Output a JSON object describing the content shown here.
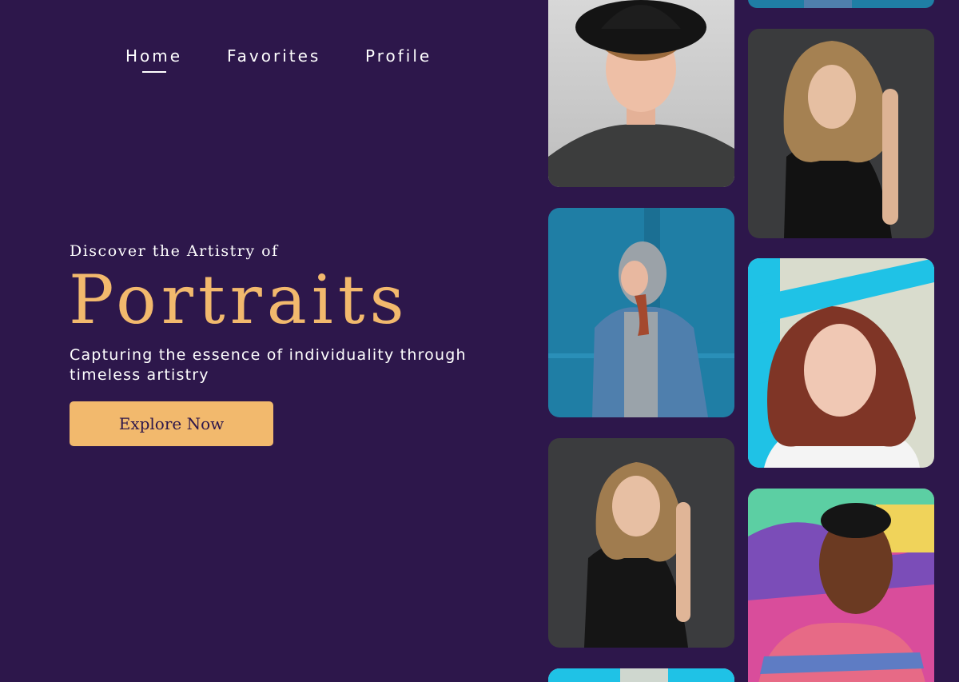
{
  "nav": {
    "items": [
      {
        "label": "Home",
        "active": true
      },
      {
        "label": "Favorites",
        "active": false
      },
      {
        "label": "Profile",
        "active": false
      }
    ]
  },
  "hero": {
    "eyebrow": "Discover the Artistry of",
    "title": "Portraits",
    "description": "Capturing the essence of individuality through timeless artistry",
    "cta_label": "Explore Now"
  },
  "colors": {
    "background": "#2d174b",
    "accent": "#f2b96d",
    "text": "#ffffff"
  },
  "gallery": {
    "photos": [
      {
        "subject": "young man with curly hair and black hat"
      },
      {
        "subject": "woman in hoodie and denim jacket on blue wall"
      },
      {
        "subject": "woman with wavy hair in black top on grey"
      },
      {
        "subject": "woman with long hair on grey background"
      },
      {
        "subject": "red-haired woman near turquoise window frame"
      },
      {
        "subject": "man in striped shirt in front of graffiti"
      }
    ]
  }
}
